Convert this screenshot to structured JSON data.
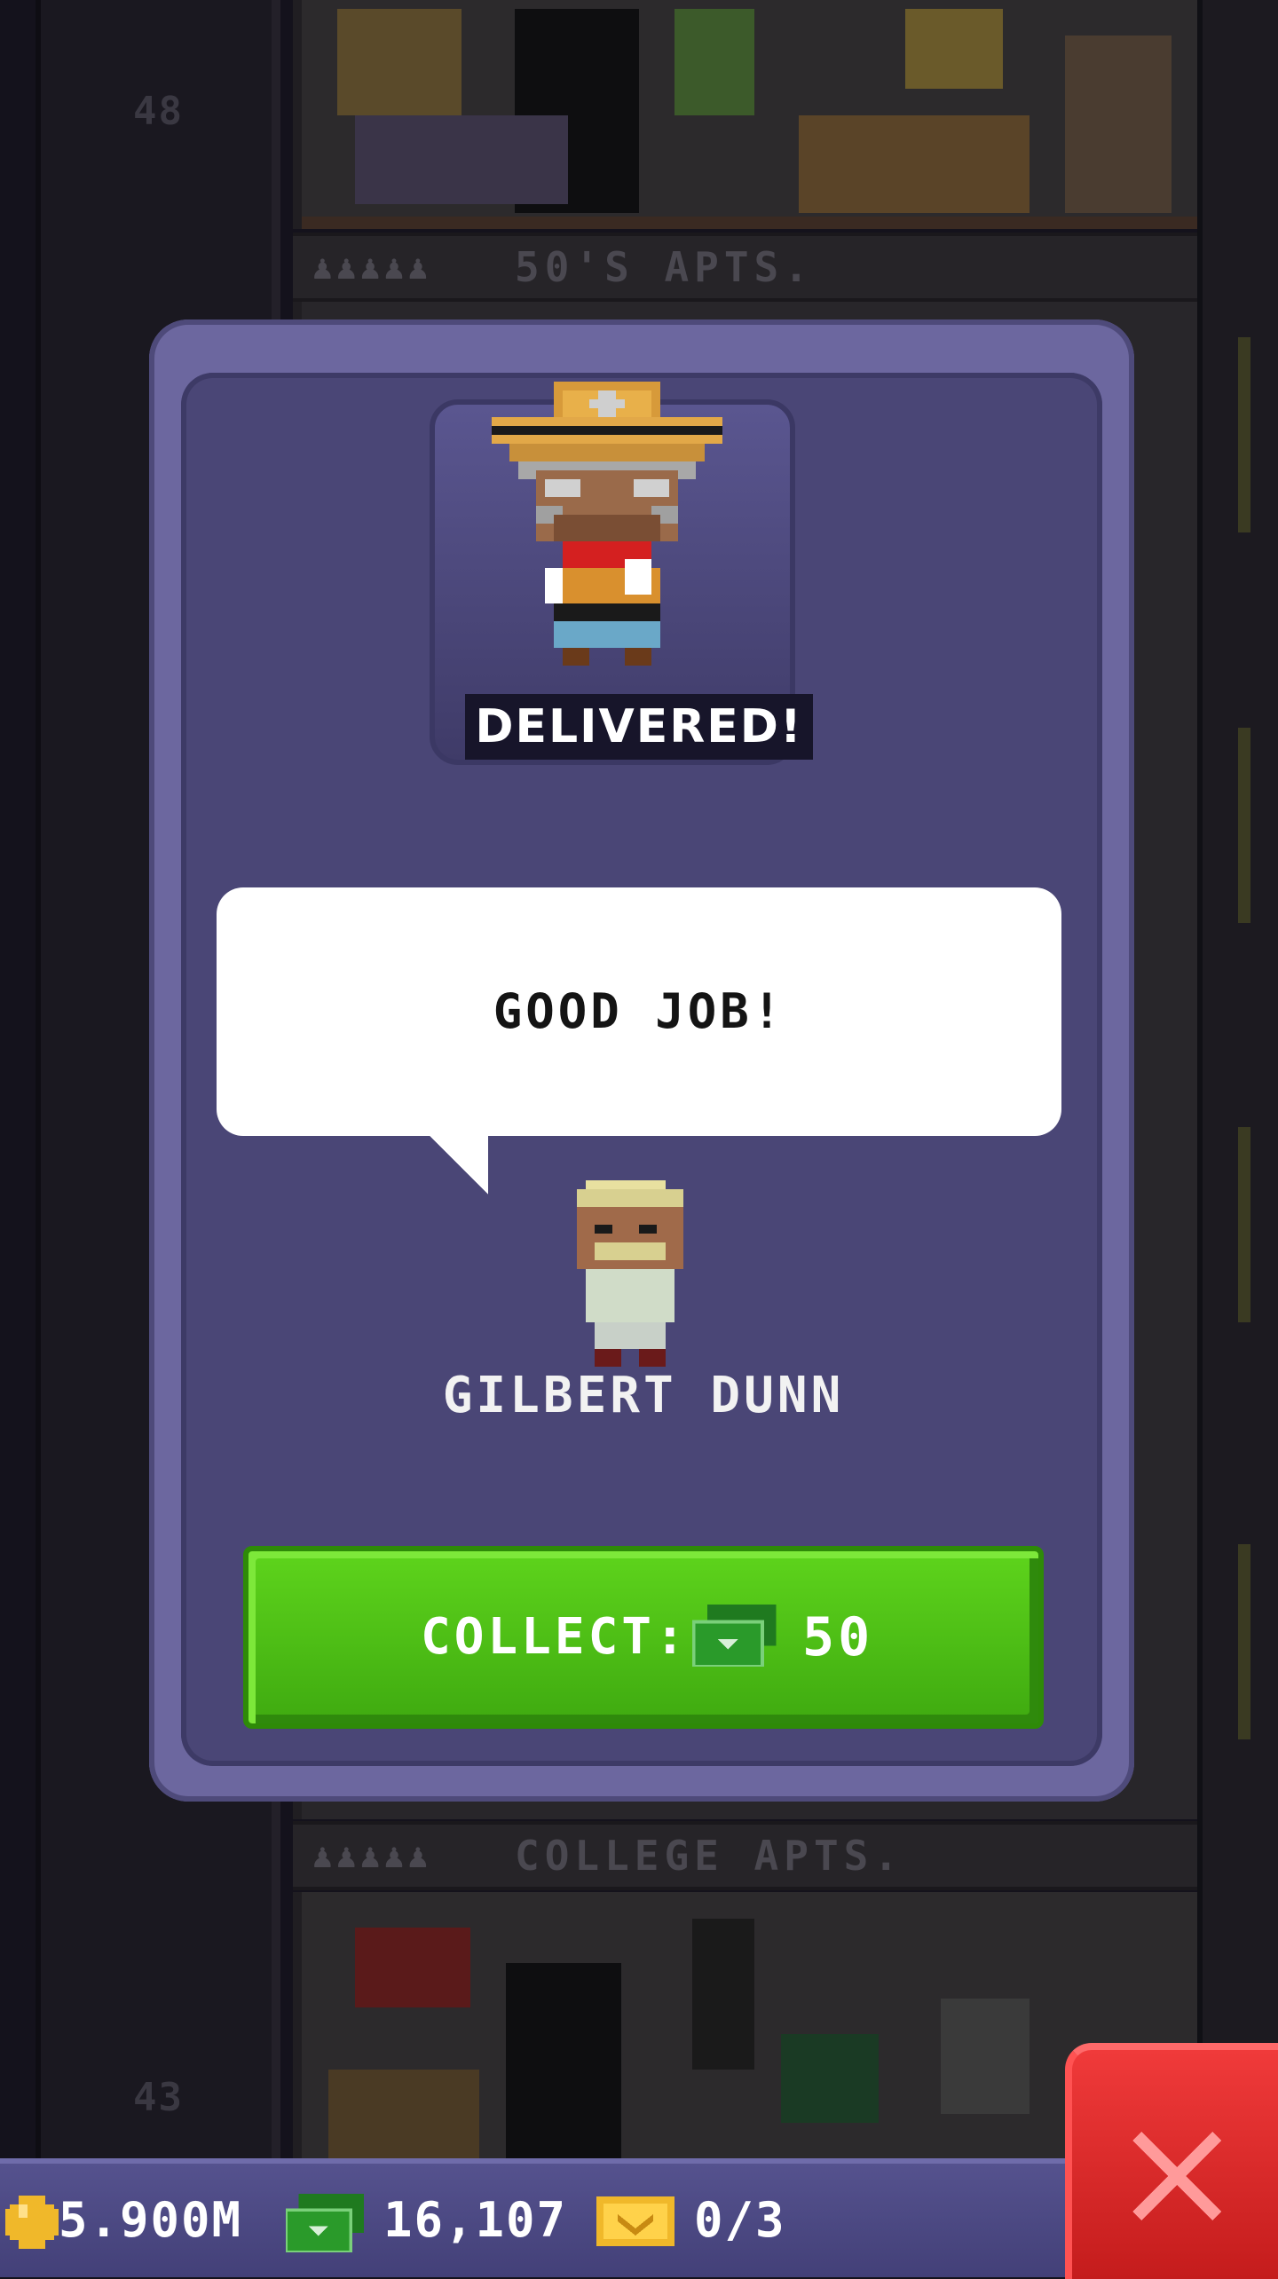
{
  "background": {
    "floor_numbers": [
      "48",
      "43"
    ],
    "floor_labels": [
      {
        "people": "♟♟♟♟♟",
        "name": "50'S APTS."
      },
      {
        "people": "♟♟♟♟♟",
        "name": "COLLEGE APTS."
      }
    ]
  },
  "modal": {
    "status_label": "DELIVERED!",
    "speech_text": "GOOD JOB!",
    "npc_name": "GILBERT DUNN",
    "collect": {
      "label": "COLLECT:",
      "currency_icon": "bux-icon",
      "amount": "50"
    }
  },
  "status_bar": {
    "coins": {
      "icon": "coin-icon",
      "value": "5.900M"
    },
    "bux": {
      "icon": "bux-icon",
      "value": "16,107"
    },
    "tickets": {
      "icon": "ticket-icon",
      "value": "0/3"
    }
  },
  "close_button": {
    "icon": "close-icon"
  },
  "colors": {
    "modal_outer": "#6c679f",
    "modal_inner": "#4a4676",
    "collect_green": "#4cc214",
    "close_red": "#e02828",
    "status_bar": "#4d4a84"
  }
}
